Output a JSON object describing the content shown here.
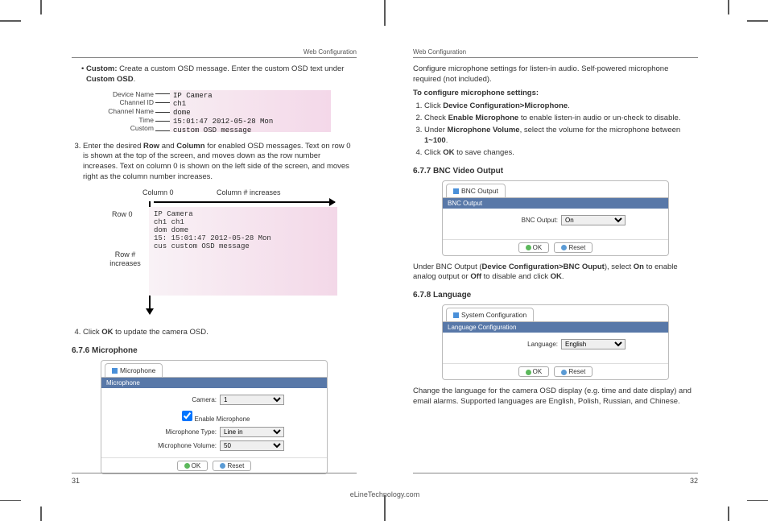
{
  "header": {
    "section": "Web Configuration"
  },
  "footer": {
    "left_page": "31",
    "right_page": "32",
    "site": "eLineTechnology.com"
  },
  "left": {
    "custom_line": "• Custom: Create a custom OSD message. Enter the custom OSD text under Custom OSD.",
    "fig1": {
      "labels": [
        "Device Name",
        "Channel ID",
        "Channel Name",
        "Time",
        "Custom"
      ],
      "panel": [
        "IP Camera",
        "ch1",
        "dome",
        "15:01:47 2012-05-28 Mon",
        "custom OSD message"
      ]
    },
    "step3": "Enter the desired Row and Column for enabled OSD messages.  Text on row 0 is shown at the top of the screen, and moves down as the row number increases. Text on column 0 is shown on the left side of the screen, and moves right as the column number increases.",
    "fig2": {
      "col0": "Column 0",
      "colInc": "Column # increases",
      "row0": "Row 0",
      "rowInc": "Row # increases",
      "panel": [
        "IP Camera",
        "ch1 ch1",
        "dom dome",
        "15: 15:01:47 2012-05-28 Mon",
        "cus custom OSD message"
      ]
    },
    "step4": "Click OK to update the camera OSD.",
    "section676": "6.7.6 Microphone",
    "mic": {
      "tab": "Microphone",
      "bar": "Microphone",
      "camera_label": "Camera:",
      "camera_value": "1",
      "enable": "Enable Microphone",
      "type_label": "Microphone Type:",
      "type_value": "Line in",
      "volume_label": "Microphone Volume:",
      "volume_value": "50",
      "ok": "OK",
      "reset": "Reset"
    }
  },
  "right": {
    "intro": "Configure microphone settings for listen-in audio. Self-powered microphone required (not included).",
    "configTitle": "To configure microphone settings:",
    "steps": {
      "s1": "Click Device Configuration>Microphone.",
      "s2": "Check Enable Microphone to enable listen-in audio or un-check to disable.",
      "s3": "Under Microphone Volume, select the volume for the microphone between 1~100.",
      "s4": "Click OK to save changes."
    },
    "section677": "6.7.7 BNC Video Output",
    "bnc": {
      "tab": "BNC Output",
      "bar": "BNC Output",
      "label": "BNC Output:",
      "value": "On",
      "ok": "OK",
      "reset": "Reset"
    },
    "bncText": "Under BNC Output (Device Configuration>BNC Ouput), select On to enable analog output or Off to disable and click OK.",
    "section678": "6.7.8 Language",
    "lang": {
      "tab": "System Configuration",
      "bar": "Language Configuration",
      "label": "Language:",
      "value": "English",
      "ok": "OK",
      "reset": "Reset"
    },
    "langText": "Change the language for the camera OSD display (e.g. time and date display) and email alarms. Supported languages are English, Polish, Russian, and Chinese."
  }
}
